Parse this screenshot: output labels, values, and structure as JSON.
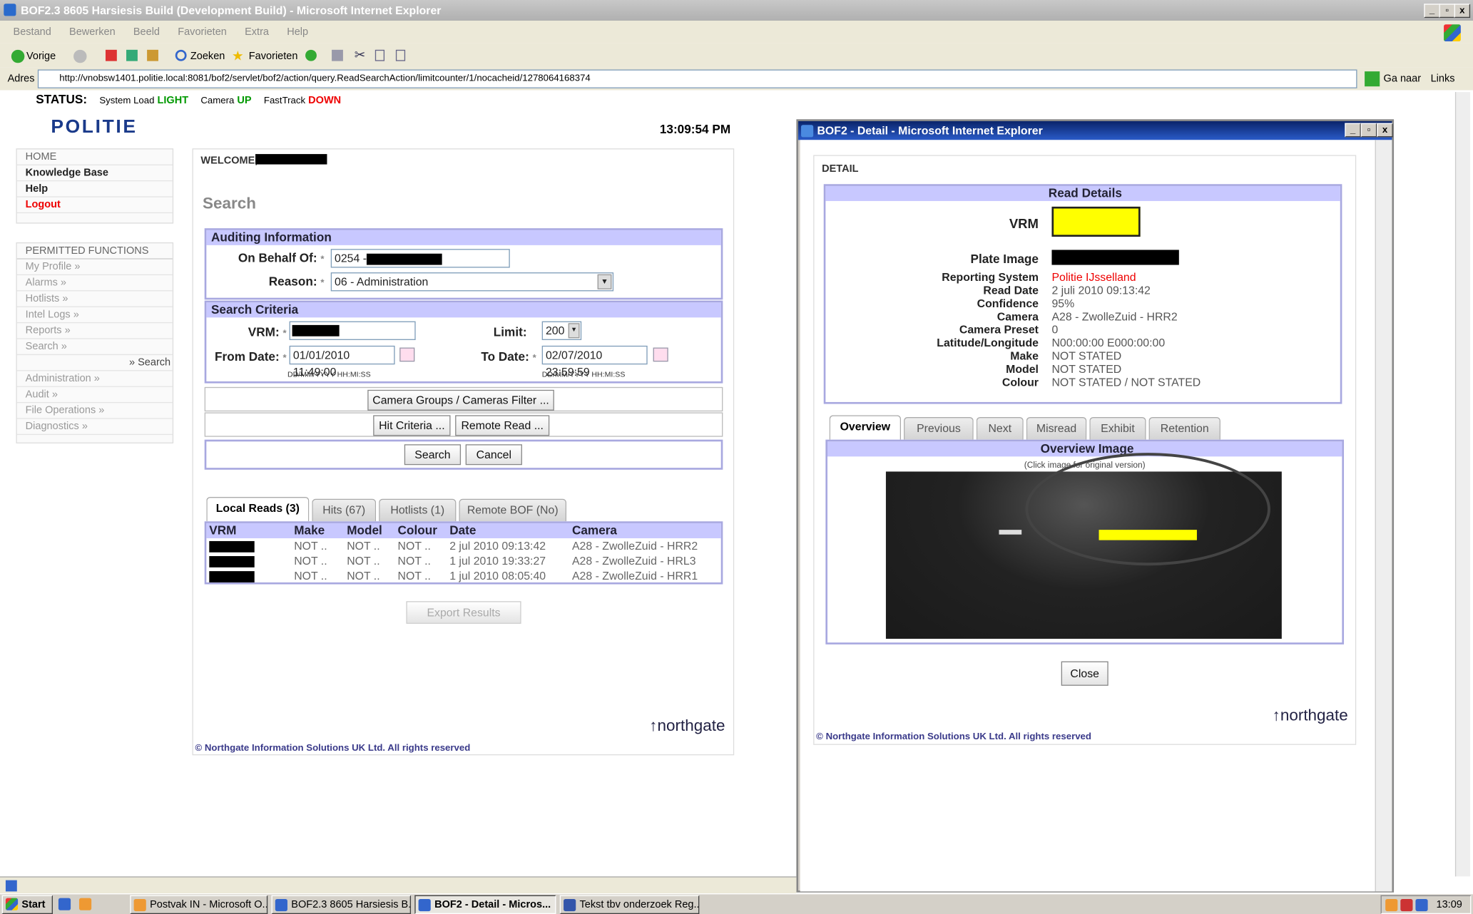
{
  "ie": {
    "title": "BOF2.3 8605 Harsiesis Build (Development Build) - Microsoft Internet Explorer",
    "menu": [
      "Bestand",
      "Bewerken",
      "Beeld",
      "Favorieten",
      "Extra",
      "Help"
    ],
    "toolbar": {
      "back": "Vorige",
      "search": "Zoeken",
      "favorites": "Favorieten"
    },
    "address_label": "Adres",
    "url": "http://vnobsw1401.politie.local:8081/bof2/servlet/bof2/action/query.ReadSearchAction/limitcounter/1/nocacheid/1278064168374",
    "go": "Ga naar",
    "links": "Links"
  },
  "status": {
    "label": "STATUS:",
    "load_label": "System Load",
    "load_value": "LIGHT",
    "camera_label": "Camera",
    "camera_value": "UP",
    "fasttrack_label": "FastTrack",
    "fasttrack_value": "DOWN",
    "clock": "13:09:54 PM"
  },
  "logo": "POLITIE",
  "nav": {
    "items": [
      "HOME",
      "Knowledge Base",
      "Help",
      "Logout"
    ],
    "section": "PERMITTED FUNCTIONS",
    "functions": [
      "My Profile »",
      "Alarms »",
      "Hotlists »",
      "Intel Logs »",
      "Reports »",
      "Search »",
      "» Search",
      "Administration »",
      "Audit »",
      "File Operations »",
      "Diagnostics »"
    ]
  },
  "main": {
    "welcome": "WELCOME,",
    "title": "Search",
    "auditing": {
      "header": "Auditing Information",
      "behalf_label": "On Behalf Of:",
      "behalf_value": "0254 -",
      "reason_label": "Reason:",
      "reason_value": "06 - Administration"
    },
    "criteria": {
      "header": "Search Criteria",
      "vrm_label": "VRM:",
      "limit_label": "Limit:",
      "limit_value": "200",
      "from_label": "From Date:",
      "from_value": "01/01/2010 11:49:00",
      "to_label": "To Date:",
      "to_value": "02/07/2010 23:59:59",
      "format": "DD/MM/YYYY HH:MI:SS"
    },
    "buttons": {
      "camera_filter": "Camera Groups / Cameras Filter ...",
      "hit_criteria": "Hit Criteria ...",
      "remote_read": "Remote Read ...",
      "search": "Search",
      "cancel": "Cancel",
      "export": "Export Results"
    },
    "tabs": [
      "Local Reads (3)",
      "Hits (67)",
      "Hotlists (1)",
      "Remote BOF (No)"
    ],
    "table": {
      "columns": [
        "VRM",
        "Make",
        "Model",
        "Colour",
        "Date",
        "Camera"
      ],
      "rows": [
        {
          "make": "NOT ..",
          "model": "NOT ..",
          "colour": "NOT ..",
          "date": "2 jul 2010 09:13:42",
          "camera": "A28 - ZwolleZuid - HRR2"
        },
        {
          "make": "NOT ..",
          "model": "NOT ..",
          "colour": "NOT ..",
          "date": "1 jul 2010 19:33:27",
          "camera": "A28 - ZwolleZuid - HRL3"
        },
        {
          "make": "NOT ..",
          "model": "NOT ..",
          "colour": "NOT ..",
          "date": "1 jul 2010 08:05:40",
          "camera": "A28 - ZwolleZuid - HRR1"
        }
      ]
    },
    "brand": "northgate",
    "copyright": "© Northgate Information Solutions UK Ltd. All rights reserved"
  },
  "detail": {
    "title": "BOF2 - Detail - Microsoft Internet Explorer",
    "section": "DETAIL",
    "read_header": "Read Details",
    "vrm_label": "VRM",
    "plate_label": "Plate Image",
    "fields": [
      {
        "label": "Reporting System",
        "value": "Politie IJsselland"
      },
      {
        "label": "Read Date",
        "value": "2 juli 2010 09:13:42"
      },
      {
        "label": "Confidence",
        "value": "95%"
      },
      {
        "label": "Camera",
        "value": "A28 - ZwolleZuid - HRR2"
      },
      {
        "label": "Camera Preset",
        "value": "0"
      },
      {
        "label": "Latitude/Longitude",
        "value": "N00:00:00 E000:00:00"
      },
      {
        "label": "Make",
        "value": "NOT STATED"
      },
      {
        "label": "Model",
        "value": "NOT STATED"
      },
      {
        "label": "Colour",
        "value": "NOT STATED / NOT STATED"
      }
    ],
    "tabs": [
      "Overview",
      "Previous",
      "Next",
      "Misread",
      "Exhibit",
      "Retention"
    ],
    "overview_header": "Overview Image",
    "overview_hint": "(Click image for original version)",
    "close": "Close",
    "brand": "northgate",
    "copyright": "© Northgate Information Solutions UK Ltd. All rights reserved"
  },
  "taskbar": {
    "start": "Start",
    "tasks": [
      "Postvak IN - Microsoft O...",
      "BOF2.3 8605 Harsiesis B...",
      "BOF2 - Detail - Micros...",
      "Tekst tbv onderzoek Reg..."
    ],
    "clock": "13:09"
  },
  "colors": {
    "titlebar": "#0a246a",
    "band": "#c8c8ff",
    "highlight": "#ffff00",
    "red": "#e00000",
    "green": "#009900"
  }
}
